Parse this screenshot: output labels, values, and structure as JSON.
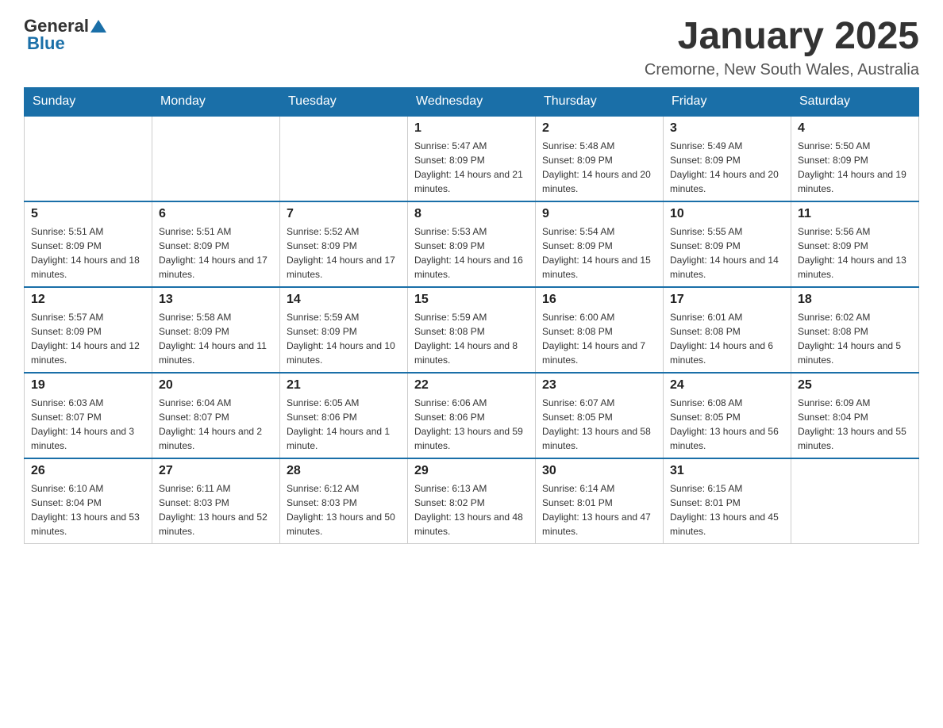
{
  "header": {
    "logo_general": "General",
    "logo_blue": "Blue",
    "month_title": "January 2025",
    "subtitle": "Cremorne, New South Wales, Australia"
  },
  "days_of_week": [
    "Sunday",
    "Monday",
    "Tuesday",
    "Wednesday",
    "Thursday",
    "Friday",
    "Saturday"
  ],
  "weeks": [
    [
      {
        "day": "",
        "sunrise": "",
        "sunset": "",
        "daylight": ""
      },
      {
        "day": "",
        "sunrise": "",
        "sunset": "",
        "daylight": ""
      },
      {
        "day": "",
        "sunrise": "",
        "sunset": "",
        "daylight": ""
      },
      {
        "day": "1",
        "sunrise": "Sunrise: 5:47 AM",
        "sunset": "Sunset: 8:09 PM",
        "daylight": "Daylight: 14 hours and 21 minutes."
      },
      {
        "day": "2",
        "sunrise": "Sunrise: 5:48 AM",
        "sunset": "Sunset: 8:09 PM",
        "daylight": "Daylight: 14 hours and 20 minutes."
      },
      {
        "day": "3",
        "sunrise": "Sunrise: 5:49 AM",
        "sunset": "Sunset: 8:09 PM",
        "daylight": "Daylight: 14 hours and 20 minutes."
      },
      {
        "day": "4",
        "sunrise": "Sunrise: 5:50 AM",
        "sunset": "Sunset: 8:09 PM",
        "daylight": "Daylight: 14 hours and 19 minutes."
      }
    ],
    [
      {
        "day": "5",
        "sunrise": "Sunrise: 5:51 AM",
        "sunset": "Sunset: 8:09 PM",
        "daylight": "Daylight: 14 hours and 18 minutes."
      },
      {
        "day": "6",
        "sunrise": "Sunrise: 5:51 AM",
        "sunset": "Sunset: 8:09 PM",
        "daylight": "Daylight: 14 hours and 17 minutes."
      },
      {
        "day": "7",
        "sunrise": "Sunrise: 5:52 AM",
        "sunset": "Sunset: 8:09 PM",
        "daylight": "Daylight: 14 hours and 17 minutes."
      },
      {
        "day": "8",
        "sunrise": "Sunrise: 5:53 AM",
        "sunset": "Sunset: 8:09 PM",
        "daylight": "Daylight: 14 hours and 16 minutes."
      },
      {
        "day": "9",
        "sunrise": "Sunrise: 5:54 AM",
        "sunset": "Sunset: 8:09 PM",
        "daylight": "Daylight: 14 hours and 15 minutes."
      },
      {
        "day": "10",
        "sunrise": "Sunrise: 5:55 AM",
        "sunset": "Sunset: 8:09 PM",
        "daylight": "Daylight: 14 hours and 14 minutes."
      },
      {
        "day": "11",
        "sunrise": "Sunrise: 5:56 AM",
        "sunset": "Sunset: 8:09 PM",
        "daylight": "Daylight: 14 hours and 13 minutes."
      }
    ],
    [
      {
        "day": "12",
        "sunrise": "Sunrise: 5:57 AM",
        "sunset": "Sunset: 8:09 PM",
        "daylight": "Daylight: 14 hours and 12 minutes."
      },
      {
        "day": "13",
        "sunrise": "Sunrise: 5:58 AM",
        "sunset": "Sunset: 8:09 PM",
        "daylight": "Daylight: 14 hours and 11 minutes."
      },
      {
        "day": "14",
        "sunrise": "Sunrise: 5:59 AM",
        "sunset": "Sunset: 8:09 PM",
        "daylight": "Daylight: 14 hours and 10 minutes."
      },
      {
        "day": "15",
        "sunrise": "Sunrise: 5:59 AM",
        "sunset": "Sunset: 8:08 PM",
        "daylight": "Daylight: 14 hours and 8 minutes."
      },
      {
        "day": "16",
        "sunrise": "Sunrise: 6:00 AM",
        "sunset": "Sunset: 8:08 PM",
        "daylight": "Daylight: 14 hours and 7 minutes."
      },
      {
        "day": "17",
        "sunrise": "Sunrise: 6:01 AM",
        "sunset": "Sunset: 8:08 PM",
        "daylight": "Daylight: 14 hours and 6 minutes."
      },
      {
        "day": "18",
        "sunrise": "Sunrise: 6:02 AM",
        "sunset": "Sunset: 8:08 PM",
        "daylight": "Daylight: 14 hours and 5 minutes."
      }
    ],
    [
      {
        "day": "19",
        "sunrise": "Sunrise: 6:03 AM",
        "sunset": "Sunset: 8:07 PM",
        "daylight": "Daylight: 14 hours and 3 minutes."
      },
      {
        "day": "20",
        "sunrise": "Sunrise: 6:04 AM",
        "sunset": "Sunset: 8:07 PM",
        "daylight": "Daylight: 14 hours and 2 minutes."
      },
      {
        "day": "21",
        "sunrise": "Sunrise: 6:05 AM",
        "sunset": "Sunset: 8:06 PM",
        "daylight": "Daylight: 14 hours and 1 minute."
      },
      {
        "day": "22",
        "sunrise": "Sunrise: 6:06 AM",
        "sunset": "Sunset: 8:06 PM",
        "daylight": "Daylight: 13 hours and 59 minutes."
      },
      {
        "day": "23",
        "sunrise": "Sunrise: 6:07 AM",
        "sunset": "Sunset: 8:05 PM",
        "daylight": "Daylight: 13 hours and 58 minutes."
      },
      {
        "day": "24",
        "sunrise": "Sunrise: 6:08 AM",
        "sunset": "Sunset: 8:05 PM",
        "daylight": "Daylight: 13 hours and 56 minutes."
      },
      {
        "day": "25",
        "sunrise": "Sunrise: 6:09 AM",
        "sunset": "Sunset: 8:04 PM",
        "daylight": "Daylight: 13 hours and 55 minutes."
      }
    ],
    [
      {
        "day": "26",
        "sunrise": "Sunrise: 6:10 AM",
        "sunset": "Sunset: 8:04 PM",
        "daylight": "Daylight: 13 hours and 53 minutes."
      },
      {
        "day": "27",
        "sunrise": "Sunrise: 6:11 AM",
        "sunset": "Sunset: 8:03 PM",
        "daylight": "Daylight: 13 hours and 52 minutes."
      },
      {
        "day": "28",
        "sunrise": "Sunrise: 6:12 AM",
        "sunset": "Sunset: 8:03 PM",
        "daylight": "Daylight: 13 hours and 50 minutes."
      },
      {
        "day": "29",
        "sunrise": "Sunrise: 6:13 AM",
        "sunset": "Sunset: 8:02 PM",
        "daylight": "Daylight: 13 hours and 48 minutes."
      },
      {
        "day": "30",
        "sunrise": "Sunrise: 6:14 AM",
        "sunset": "Sunset: 8:01 PM",
        "daylight": "Daylight: 13 hours and 47 minutes."
      },
      {
        "day": "31",
        "sunrise": "Sunrise: 6:15 AM",
        "sunset": "Sunset: 8:01 PM",
        "daylight": "Daylight: 13 hours and 45 minutes."
      },
      {
        "day": "",
        "sunrise": "",
        "sunset": "",
        "daylight": ""
      }
    ]
  ]
}
